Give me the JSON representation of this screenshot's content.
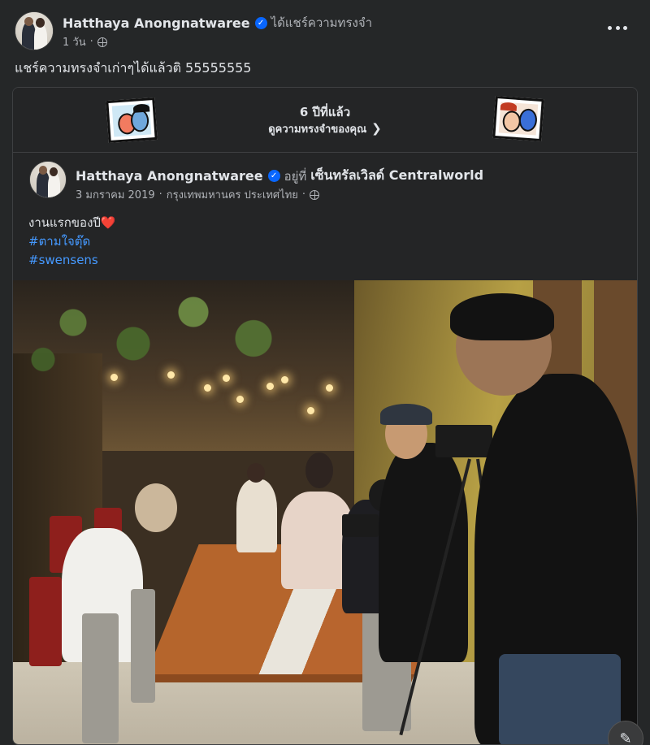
{
  "post": {
    "author": "Hatthaya Anongnatwaree",
    "action": "ได้แชร์ความทรงจำ",
    "time": "1 วัน",
    "separator": "·",
    "text": "แชร์ความทรงจำเก่าๆได้แล้วติ 55555555",
    "more_label": "More options"
  },
  "memory": {
    "years_ago": "6 ปีที่แล้ว",
    "view_link": "ดูความทรงจำของคุณ",
    "chevron": "❯"
  },
  "shared_post": {
    "author": "Hatthaya Anongnatwaree",
    "at_label": "อยู่ที่",
    "place": "เซ็นทรัลเวิลด์ Centralworld",
    "date": "3 มกราคม 2019",
    "separator1": "·",
    "location": "กรุงเทพมหานคร ประเทศไทย",
    "separator2": "·",
    "text": "งานแรกของปี",
    "heart": "❤️",
    "hashtags": [
      "#ตามใจตุ๊ด",
      "#swensens"
    ]
  },
  "icons": {
    "verified": "verified-badge-icon",
    "globe": "globe-icon",
    "more": "more-dots-icon",
    "edit": "compose-icon"
  },
  "colors": {
    "background": "#252728",
    "accent": "#0866ff",
    "hashtag": "#4599ff",
    "text": "#e2e5e9",
    "secondary": "#b0b3b8"
  }
}
